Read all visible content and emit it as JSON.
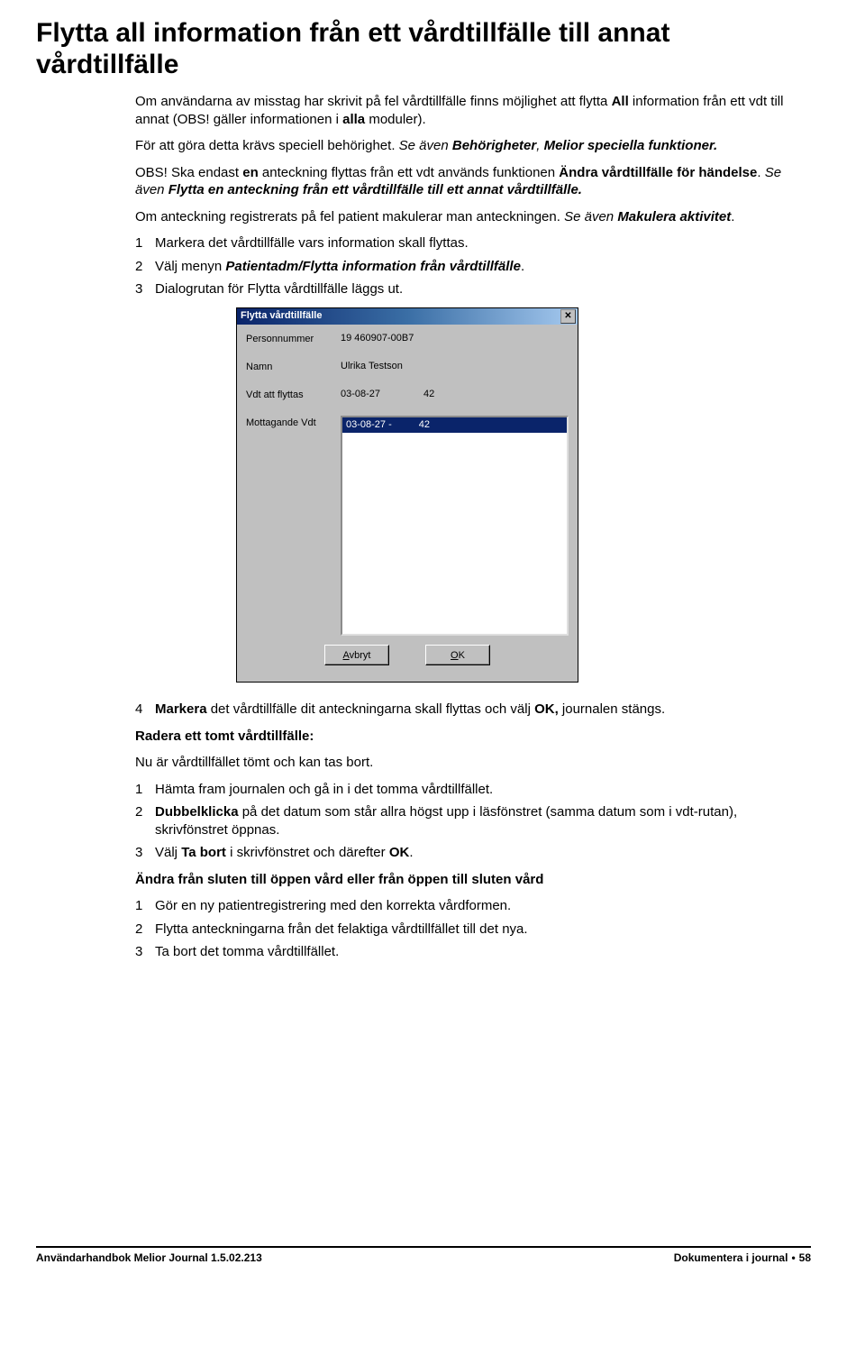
{
  "title": "Flytta all information från ett vårdtillfälle till annat vårdtillfälle",
  "p1_a": "Om användarna av misstag har skrivit på fel vårdtillfälle finns möjlighet att flytta ",
  "p1_b": "All",
  "p1_c": " information från ett vdt till annat (OBS! gäller informationen i ",
  "p1_d": "alla",
  "p1_e": " moduler).",
  "p2_a": "För att göra detta krävs speciell behörighet. ",
  "p2_b": "Se även ",
  "p2_c": "Behörigheter",
  "p2_d": ", ",
  "p2_e": "Melior speciella funktioner.",
  "p3_a": "OBS! Ska endast ",
  "p3_b": "en",
  "p3_c": " anteckning flyttas från ett vdt används funktionen ",
  "p3_d": "Ändra vårdtillfälle för händelse",
  "p3_e": ". ",
  "p3_f": "Se även ",
  "p3_g": "Flytta en anteckning från ett vårdtillfälle till ett annat vårdtillfälle.",
  "p4_a": "Om anteckning registrerats på fel patient makulerar man anteckningen. ",
  "p4_b": "Se även ",
  "p4_c": "Makulera aktivitet",
  "p4_d": ".",
  "list1": {
    "i1": "Markera det vårdtillfälle vars information skall flyttas.",
    "i2_a": "Välj menyn ",
    "i2_b": "Patientadm/Flytta information från vårdtillfälle",
    "i2_c": ".",
    "i3": "Dialogrutan för Flytta vårdtillfälle läggs ut."
  },
  "dialog": {
    "title": "Flytta vårdtillfälle",
    "lbl_personnummer": "Personnummer",
    "val_personnummer": "19 460907-00B7",
    "lbl_namn": "Namn",
    "val_namn": "Ulrika Testson",
    "lbl_vdt": "Vdt att flyttas",
    "val_vdt_date": "03-08-27",
    "val_vdt_code": "42",
    "lbl_mott": "Mottagande Vdt",
    "sel_date": "03-08-27 -",
    "sel_code": "42",
    "btn_avbryt": "vbryt",
    "btn_avbryt_ul": "A",
    "btn_ok": "K",
    "btn_ok_ul": "O"
  },
  "list2": {
    "i4_a": "Markera",
    "i4_b": " det vårdtillfälle dit anteckningarna skall flyttas och välj ",
    "i4_c": "OK,",
    "i4_d": " journalen stängs."
  },
  "h_radera": "Radera ett tomt vårdtillfälle:",
  "p_radera": "Nu är vårdtillfället tömt och kan tas bort.",
  "list3": {
    "i1": "Hämta fram journalen och gå in i det tomma vårdtillfället.",
    "i2_a": "Dubbelklicka",
    "i2_b": " på det datum som står allra högst upp i läsfönstret (samma datum som i vdt-rutan), skrivfönstret öppnas.",
    "i3_a": "Välj ",
    "i3_b": "Ta bort",
    "i3_c": " i skrivfönstret och därefter ",
    "i3_d": "OK",
    "i3_e": "."
  },
  "h_andra": "Ändra från sluten till öppen vård eller från öppen till sluten vård",
  "list4": {
    "i1": "Gör en ny patientregistrering med den korrekta vårdformen.",
    "i2": "Flytta anteckningarna från det felaktiga vårdtillfället till det nya.",
    "i3": "Ta bort det tomma vårdtillfället."
  },
  "footer": {
    "left": "Användarhandbok Melior Journal 1.5.02.213",
    "right_a": "Dokumentera i journal",
    "right_b": "58"
  }
}
